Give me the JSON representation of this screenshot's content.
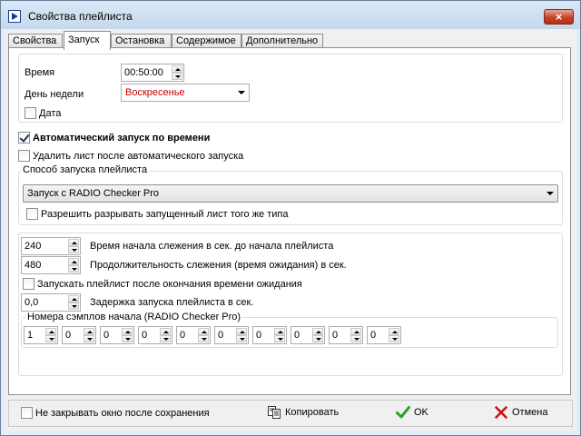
{
  "window": {
    "title": "Свойства плейлиста",
    "close_label": "×"
  },
  "tabs": [
    {
      "label": "Свойства"
    },
    {
      "label": "Запуск",
      "active": true
    },
    {
      "label": "Остановка"
    },
    {
      "label": "Содержимое"
    },
    {
      "label": "Дополнительно"
    }
  ],
  "time_group": {
    "time_label": "Время",
    "time_value": "00:50:00",
    "weekday_label": "День недели",
    "weekday_value": "Воскресенье",
    "weekday_color": "#cc0000",
    "date_label": "Дата",
    "date_checked": false
  },
  "auto_start": {
    "label": "Автоматический запуск по времени",
    "checked": true
  },
  "delete_after": {
    "label": "Удалить лист после автоматического запуска",
    "checked": false
  },
  "start_method": {
    "group_label": "Способ запуска плейлиста",
    "value": "Запуск с RADIO Checker Pro",
    "allow_break_label": "Разрешить разрывать запущенный лист того же типа",
    "allow_break_checked": false
  },
  "monitoring": {
    "start_value": "240",
    "start_label": "Время начала слежения в сек. до начала плейлиста",
    "duration_value": "480",
    "duration_label": "Продолжительность слежения (время ожидания) в сек.",
    "launch_after_label": "Запускать плейлист после окончания времени ожидания",
    "launch_after_checked": false,
    "delay_value": "0,0",
    "delay_label": "Задержка запуска плейлиста в сек.",
    "samples_label": "Номера сэмплов начала (RADIO Checker Pro)",
    "samples": [
      "1",
      "0",
      "0",
      "0",
      "0",
      "0",
      "0",
      "0",
      "0",
      "0"
    ]
  },
  "bottom": {
    "keep_open_label": "Не закрывать окно после сохранения",
    "keep_open_checked": false,
    "copy_label": "Копировать",
    "ok_label": "OK",
    "cancel_label": "Отмена"
  }
}
